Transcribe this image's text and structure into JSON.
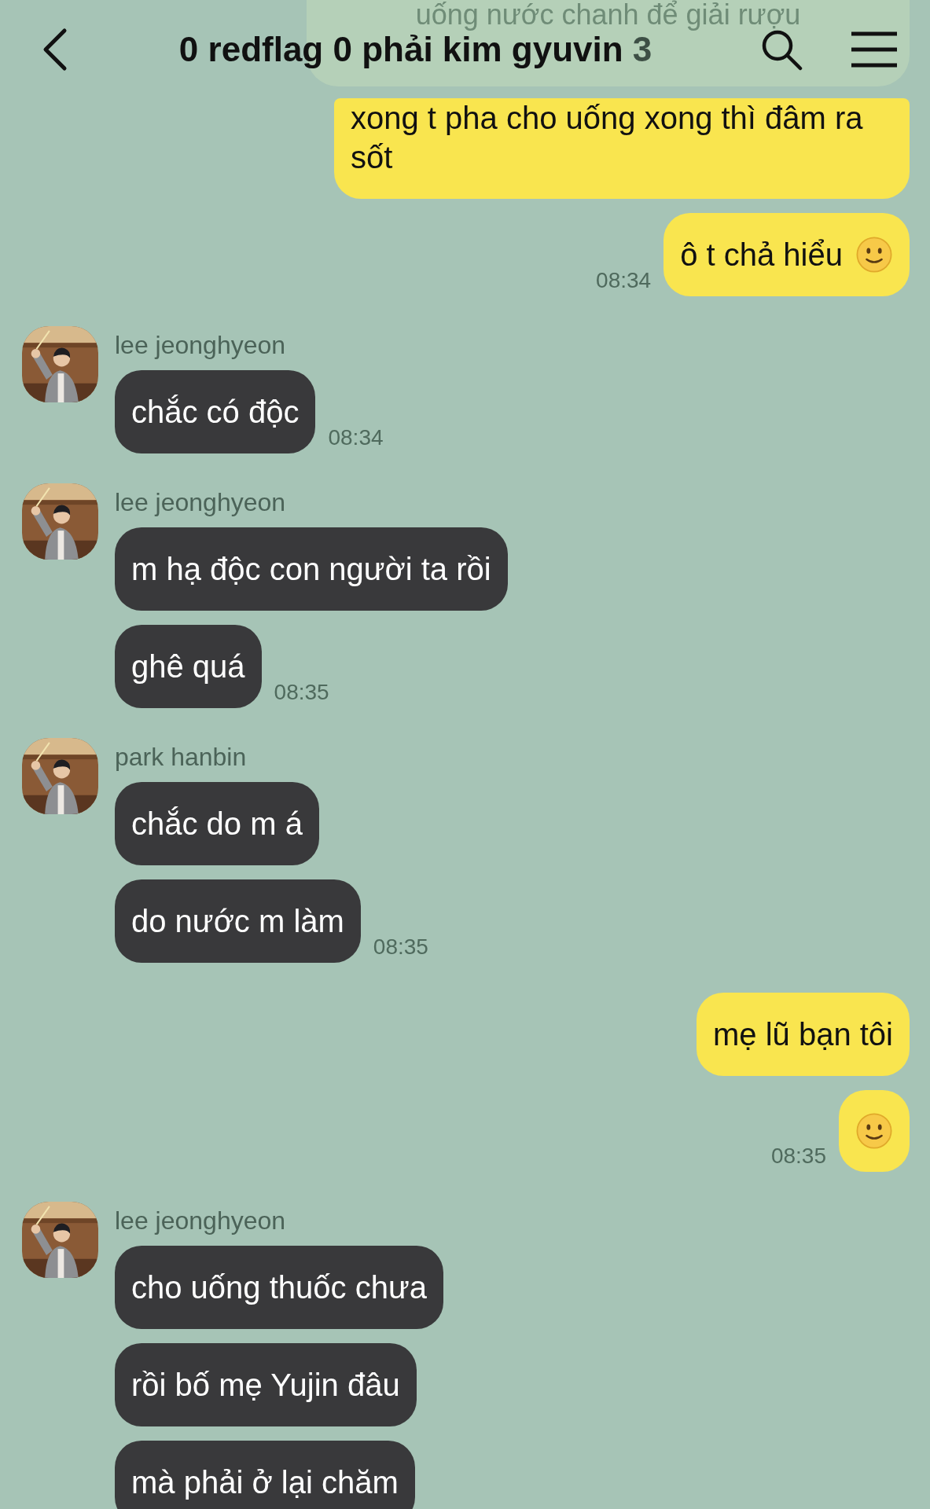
{
  "header": {
    "ghost_message": "uống nước chanh để giải rượu",
    "title": "0 redflag 0 phải kim gyuvin",
    "member_count": "3"
  },
  "groups": [
    {
      "outgoing": true,
      "time": "08:34",
      "bubbles": [
        {
          "kind": "text",
          "text": "xong t pha cho uống xong thì đâm ra sốt"
        },
        {
          "kind": "text-smiley",
          "text": "ô t chả hiểu"
        }
      ]
    },
    {
      "outgoing": false,
      "sender": "lee jeonghyeon",
      "avatar": {
        "kind": "picture"
      },
      "time": "08:34",
      "bubbles": [
        {
          "kind": "text",
          "text": "chắc có độc"
        }
      ]
    },
    {
      "outgoing": false,
      "sender": "lee jeonghyeon",
      "avatar": {
        "kind": "picture"
      },
      "time": "08:35",
      "bubbles": [
        {
          "kind": "text",
          "text": "m hạ độc con người ta rồi"
        },
        {
          "kind": "text",
          "text": "ghê quá"
        }
      ]
    },
    {
      "outgoing": false,
      "sender": "park hanbin",
      "avatar": {
        "kind": "picture"
      },
      "time": "08:35",
      "bubbles": [
        {
          "kind": "text",
          "text": "chắc do m á"
        },
        {
          "kind": "text",
          "text": "do nước m làm"
        }
      ]
    },
    {
      "outgoing": true,
      "time": "08:35",
      "bubbles": [
        {
          "kind": "text",
          "text": "mẹ lũ bạn tôi"
        },
        {
          "kind": "smiley"
        }
      ]
    },
    {
      "outgoing": false,
      "sender": "lee jeonghyeon",
      "avatar": {
        "kind": "picture"
      },
      "bubbles": [
        {
          "kind": "text",
          "text": "cho uống thuốc chưa"
        },
        {
          "kind": "text",
          "text": "rồi bố mẹ Yujin đâu"
        },
        {
          "kind": "text",
          "text": "mà phải ở lại chăm"
        }
      ]
    }
  ]
}
